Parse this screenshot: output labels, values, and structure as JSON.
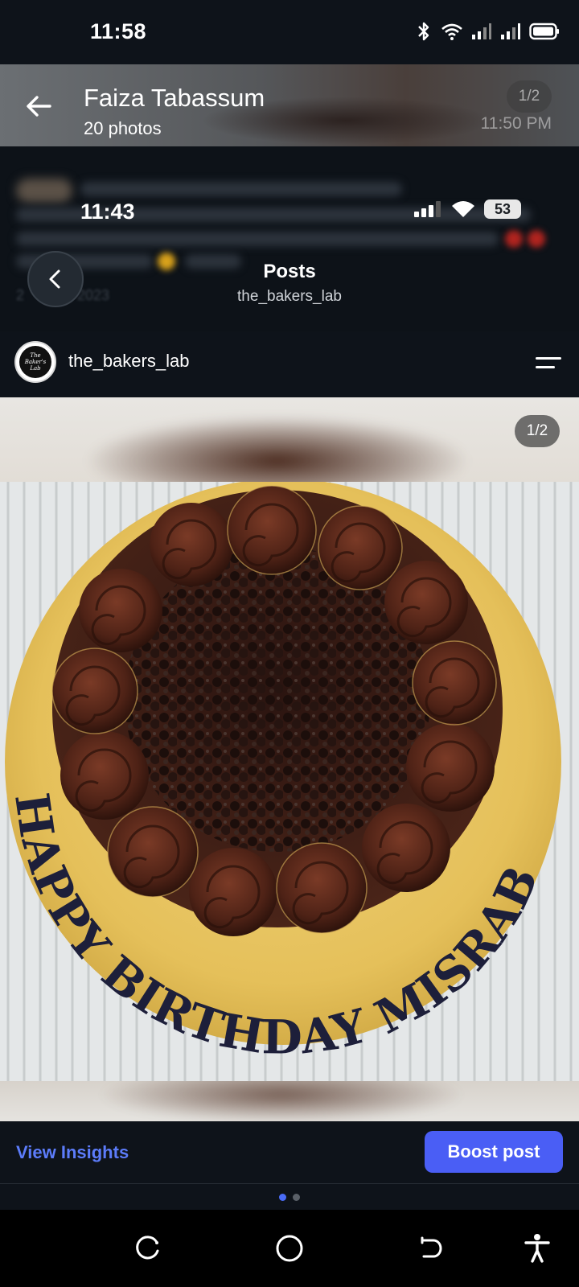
{
  "status_bar": {
    "time": "11:58"
  },
  "gallery_header": {
    "title": "Faiza Tabassum",
    "subtitle": "20 photos",
    "counter": "1/2",
    "time": "11:50 PM"
  },
  "embedded_screen": {
    "time": "11:43",
    "battery": "53",
    "title": "Posts",
    "subtitle": "the_bakers_lab",
    "date_fragment": "2",
    "date_year": "r 2023"
  },
  "post": {
    "username": "the_bakers_lab",
    "image_counter": "1/2",
    "cake_inscription": "HAPPY BIRTHDAY MISRAB"
  },
  "actions": {
    "view_insights": "View Insights",
    "boost_post": "Boost post"
  },
  "pagination": {
    "total": 2,
    "active": 1
  },
  "colors": {
    "background": "#0e131a",
    "accent": "#4a5ef5",
    "link": "#5c7cfa",
    "cake_board": "#e8c45a",
    "chocolate": "#3a1a12"
  },
  "icons": [
    "bluetooth-icon",
    "wifi-icon",
    "signal-icon",
    "battery-icon",
    "back-arrow-icon",
    "chevron-left-icon",
    "menu-icon",
    "recents-icon",
    "home-icon",
    "back-icon",
    "accessibility-icon"
  ]
}
